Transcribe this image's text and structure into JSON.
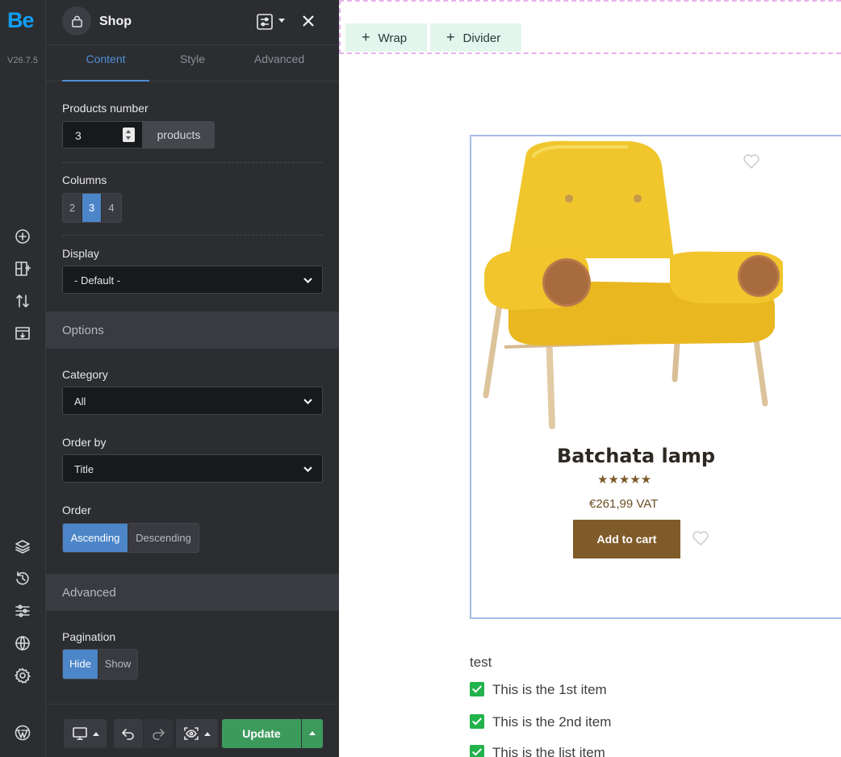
{
  "app": {
    "logo": "Be",
    "version": "V26.7.5"
  },
  "panel": {
    "title": "Shop",
    "tabs": [
      "Content",
      "Style",
      "Advanced"
    ],
    "products_number": {
      "label": "Products number",
      "value": "3",
      "suffix": "products"
    },
    "columns": {
      "label": "Columns",
      "options": [
        "2",
        "3",
        "4"
      ],
      "selected": "3"
    },
    "display": {
      "label": "Display",
      "value": "- Default -"
    },
    "options_section": "Options",
    "category": {
      "label": "Category",
      "value": "All"
    },
    "order_by": {
      "label": "Order by",
      "value": "Title"
    },
    "order": {
      "label": "Order",
      "options": [
        "Ascending",
        "Descending"
      ],
      "selected": "Ascending"
    },
    "advanced_section": "Advanced",
    "pagination": {
      "label": "Pagination",
      "options": [
        "Hide",
        "Show"
      ],
      "selected": "Hide"
    },
    "update_label": "Update"
  },
  "canvas": {
    "buttons": [
      "Wrap",
      "Divider"
    ],
    "product": {
      "name": "Batchata lamp",
      "rating_stars": 5,
      "price": "€261,99 VAT",
      "add_to_cart": "Add to cart"
    },
    "list_title": "test",
    "list_items": [
      "This is the 1st item",
      "This is the 2nd item",
      "This is the list item"
    ]
  },
  "colors": {
    "accent": "#4c86c8",
    "update": "#3d9a5d",
    "cart": "#805b2a",
    "brand": "#0f9ff5"
  }
}
